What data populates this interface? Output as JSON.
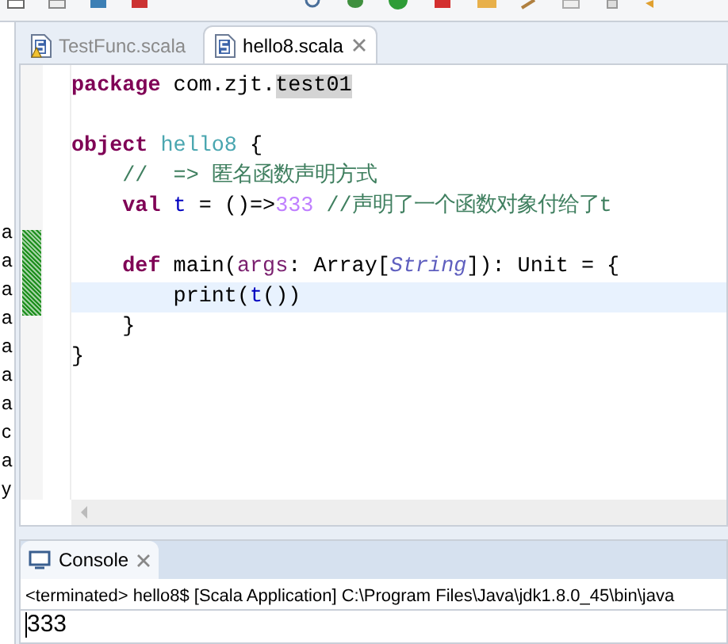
{
  "explorer_fragments": [
    "a",
    "a",
    "a",
    "a",
    "a",
    "a",
    "a",
    "c",
    "a",
    "y"
  ],
  "tabs": [
    {
      "label": "TestFunc.scala",
      "selected": false,
      "warning": true
    },
    {
      "label": "hello8.scala",
      "selected": true,
      "warning": false
    }
  ],
  "code_lines": [
    {
      "highlighted": false,
      "tokens": [
        {
          "kind": "keyword",
          "text": "package"
        },
        {
          "kind": "plain",
          "text": " com.zjt."
        },
        {
          "kind": "marked",
          "text": "test01"
        }
      ]
    },
    {
      "highlighted": false
    },
    {
      "highlighted": false,
      "tokens": [
        {
          "kind": "keyword",
          "text": "object"
        },
        {
          "kind": "object",
          "text": " hello8"
        },
        {
          "kind": "plain",
          "text": " {"
        }
      ]
    },
    {
      "highlighted": false,
      "tokens": [
        {
          "kind": "comment",
          "text": "    //  => 匿名函数声明方式"
        }
      ]
    },
    {
      "highlighted": false,
      "tokens": [
        {
          "kind": "keyword",
          "text": "    val"
        },
        {
          "kind": "variable",
          "text": " t"
        },
        {
          "kind": "plain",
          "text": " = ()=>"
        },
        {
          "kind": "number",
          "text": "333"
        },
        {
          "kind": "comment",
          "text": " //声明了一个函数对象付给了t"
        }
      ]
    },
    {
      "highlighted": false
    },
    {
      "highlighted": false,
      "tokens": [
        {
          "kind": "keyword",
          "text": "    def"
        },
        {
          "kind": "plain",
          "text": " main("
        },
        {
          "kind": "param",
          "text": "args"
        },
        {
          "kind": "plain",
          "text": ": Array["
        },
        {
          "kind": "type",
          "text": "String"
        },
        {
          "kind": "plain",
          "text": "]): Unit = {"
        }
      ]
    },
    {
      "highlighted": true,
      "tokens": [
        {
          "kind": "plain",
          "text": "        print("
        },
        {
          "kind": "variable",
          "text": "t"
        },
        {
          "kind": "plain",
          "text": "())"
        }
      ]
    },
    {
      "highlighted": false,
      "tokens": [
        {
          "kind": "plain",
          "text": "    }"
        }
      ]
    },
    {
      "highlighted": false,
      "tokens": [
        {
          "kind": "plain",
          "text": "}"
        }
      ]
    }
  ],
  "console": {
    "tab": "Console",
    "header": "<terminated> hello8$ [Scala Application] C:\\Program Files\\Java\\jdk1.8.0_45\\bin\\java",
    "output": "333"
  }
}
